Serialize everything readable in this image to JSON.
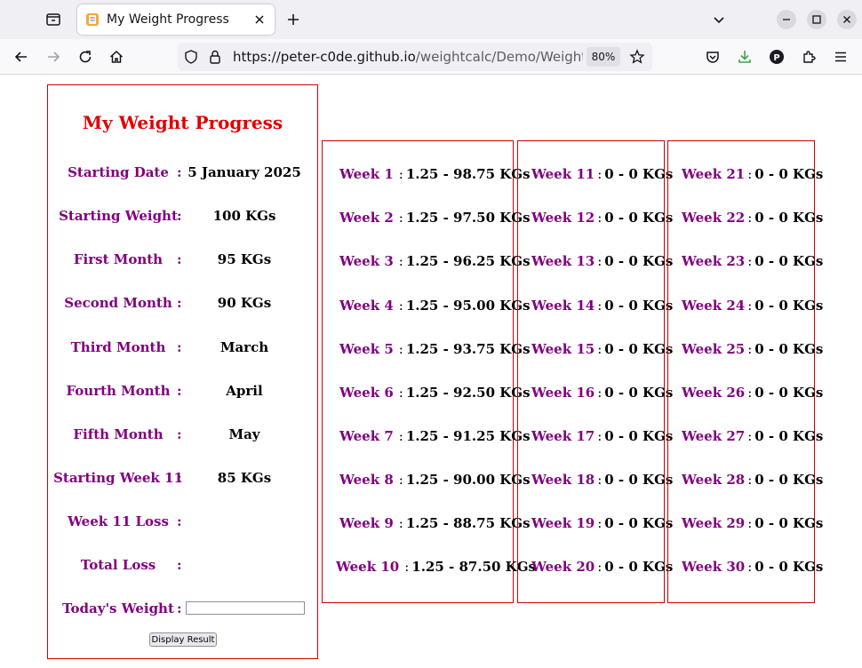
{
  "browser": {
    "tab_title": "My Weight Progress",
    "url_host": "https://peter-c0de.github.io",
    "url_path": "/weightcalc/Demo/WeightCa",
    "zoom": "80%"
  },
  "main": {
    "title": "My Weight Progress",
    "rows": [
      {
        "label": "Starting Date",
        "value": "5 January 2025"
      },
      {
        "label": "Starting Weight",
        "value": "100 KGs"
      },
      {
        "label": "First Month",
        "value": "95 KGs"
      },
      {
        "label": "Second Month",
        "value": "90 KGs"
      },
      {
        "label": "Third Month",
        "value": "March"
      },
      {
        "label": "Fourth Month",
        "value": "April"
      },
      {
        "label": "Fifth Month",
        "value": "May"
      },
      {
        "label": "Starting Week 11",
        "value": "85 KGs"
      },
      {
        "label": "Week 11 Loss",
        "value": ""
      },
      {
        "label": "Total Loss",
        "value": ""
      },
      {
        "label": "Today's Weight",
        "value": ""
      }
    ],
    "colon": ":",
    "todays_weight_value": "",
    "display_button": "Display Result"
  },
  "weeks": {
    "separator": ":",
    "col1": [
      {
        "label": "Week 1",
        "value": "1.25 - 98.75 KGs"
      },
      {
        "label": "Week 2",
        "value": "1.25 - 97.50 KGs"
      },
      {
        "label": "Week 3",
        "value": "1.25 - 96.25 KGs"
      },
      {
        "label": "Week 4",
        "value": "1.25 - 95.00 KGs"
      },
      {
        "label": "Week 5",
        "value": "1.25 - 93.75 KGs"
      },
      {
        "label": "Week 6",
        "value": "1.25 - 92.50 KGs"
      },
      {
        "label": "Week 7",
        "value": "1.25 - 91.25 KGs"
      },
      {
        "label": "Week 8",
        "value": "1.25 - 90.00 KGs"
      },
      {
        "label": "Week 9",
        "value": "1.25 - 88.75 KGs"
      },
      {
        "label": "Week 10",
        "value": "1.25 - 87.50 KGs"
      }
    ],
    "col2": [
      {
        "label": "Week 11",
        "value": "0 - 0 KGs"
      },
      {
        "label": "Week 12",
        "value": "0 - 0 KGs"
      },
      {
        "label": "Week 13",
        "value": "0 - 0 KGs"
      },
      {
        "label": "Week 14",
        "value": "0 - 0 KGs"
      },
      {
        "label": "Week 15",
        "value": "0 - 0 KGs"
      },
      {
        "label": "Week 16",
        "value": "0 - 0 KGs"
      },
      {
        "label": "Week 17",
        "value": "0 - 0 KGs"
      },
      {
        "label": "Week 18",
        "value": "0 - 0 KGs"
      },
      {
        "label": "Week 19",
        "value": "0 - 0 KGs"
      },
      {
        "label": "Week 20",
        "value": "0 - 0 KGs"
      }
    ],
    "col3": [
      {
        "label": "Week 21",
        "value": "0 - 0 KGs"
      },
      {
        "label": "Week 22",
        "value": "0 - 0 KGs"
      },
      {
        "label": "Week 23",
        "value": "0 - 0 KGs"
      },
      {
        "label": "Week 24",
        "value": "0 - 0 KGs"
      },
      {
        "label": "Week 25",
        "value": "0 - 0 KGs"
      },
      {
        "label": "Week 26",
        "value": "0 - 0 KGs"
      },
      {
        "label": "Week 27",
        "value": "0 - 0 KGs"
      },
      {
        "label": "Week 28",
        "value": "0 - 0 KGs"
      },
      {
        "label": "Week 29",
        "value": "0 - 0 KGs"
      },
      {
        "label": "Week 30",
        "value": "0 - 0 KGs"
      }
    ]
  },
  "colors": {
    "title_red": "#e00000",
    "label_purple": "#800080",
    "border_red": "#cc0000"
  }
}
